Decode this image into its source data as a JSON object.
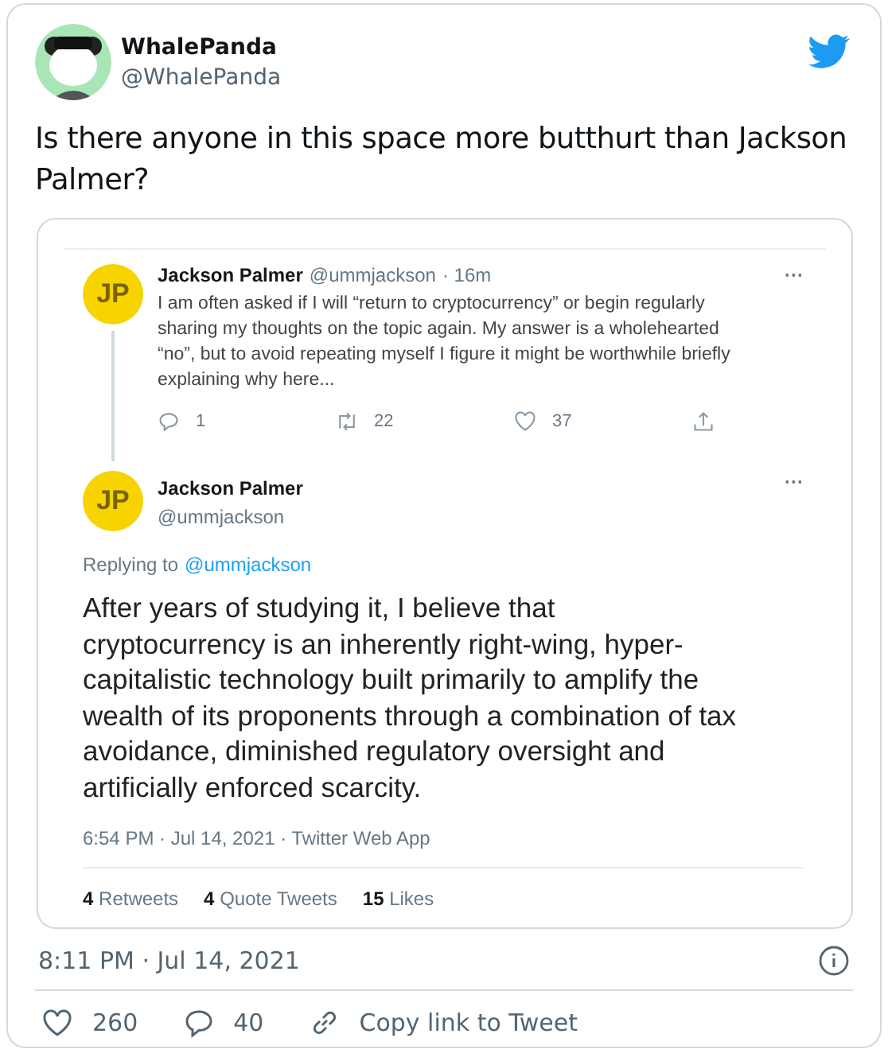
{
  "author": {
    "name": "WhalePanda",
    "handle": "@WhalePanda"
  },
  "text": "Is there anyone in this space more butthurt than Jackson Palmer?",
  "embedded_screenshot": {
    "parent_tweet": {
      "avatar_text": "JP",
      "name": "Jackson Palmer",
      "handle": "@ummjackson",
      "time": "· 16m",
      "more": "···",
      "text": "I am often asked if I will “return to cryptocurrency” or begin regularly sharing my thoughts on the topic again. My answer is a wholehearted “no”, but to avoid repeating myself I figure it might be worthwhile briefly explaining why here...",
      "replies": "1",
      "retweets": "22",
      "likes": "37"
    },
    "main_tweet": {
      "avatar_text": "JP",
      "name": "Jackson Palmer",
      "handle": "@ummjackson",
      "more": "···",
      "replying_label": "Replying to",
      "replying_handle": "@ummjackson",
      "text": "After years of studying it, I believe that cryptocurrency is an inherently right-wing, hyper-capitalistic technology built primarily to amplify the wealth of its proponents through a combination of tax avoidance, diminished regulatory oversight and artificially enforced scarcity.",
      "meta": "6:54 PM · Jul 14, 2021 · Twitter Web App",
      "stats": [
        {
          "count": "4",
          "label": "Retweets"
        },
        {
          "count": "4",
          "label": "Quote Tweets"
        },
        {
          "count": "15",
          "label": "Likes"
        }
      ]
    }
  },
  "timestamp": "8:11 PM · Jul 14, 2021",
  "actions": {
    "likes": "260",
    "replies": "40",
    "copy_link": "Copy link to Tweet"
  }
}
